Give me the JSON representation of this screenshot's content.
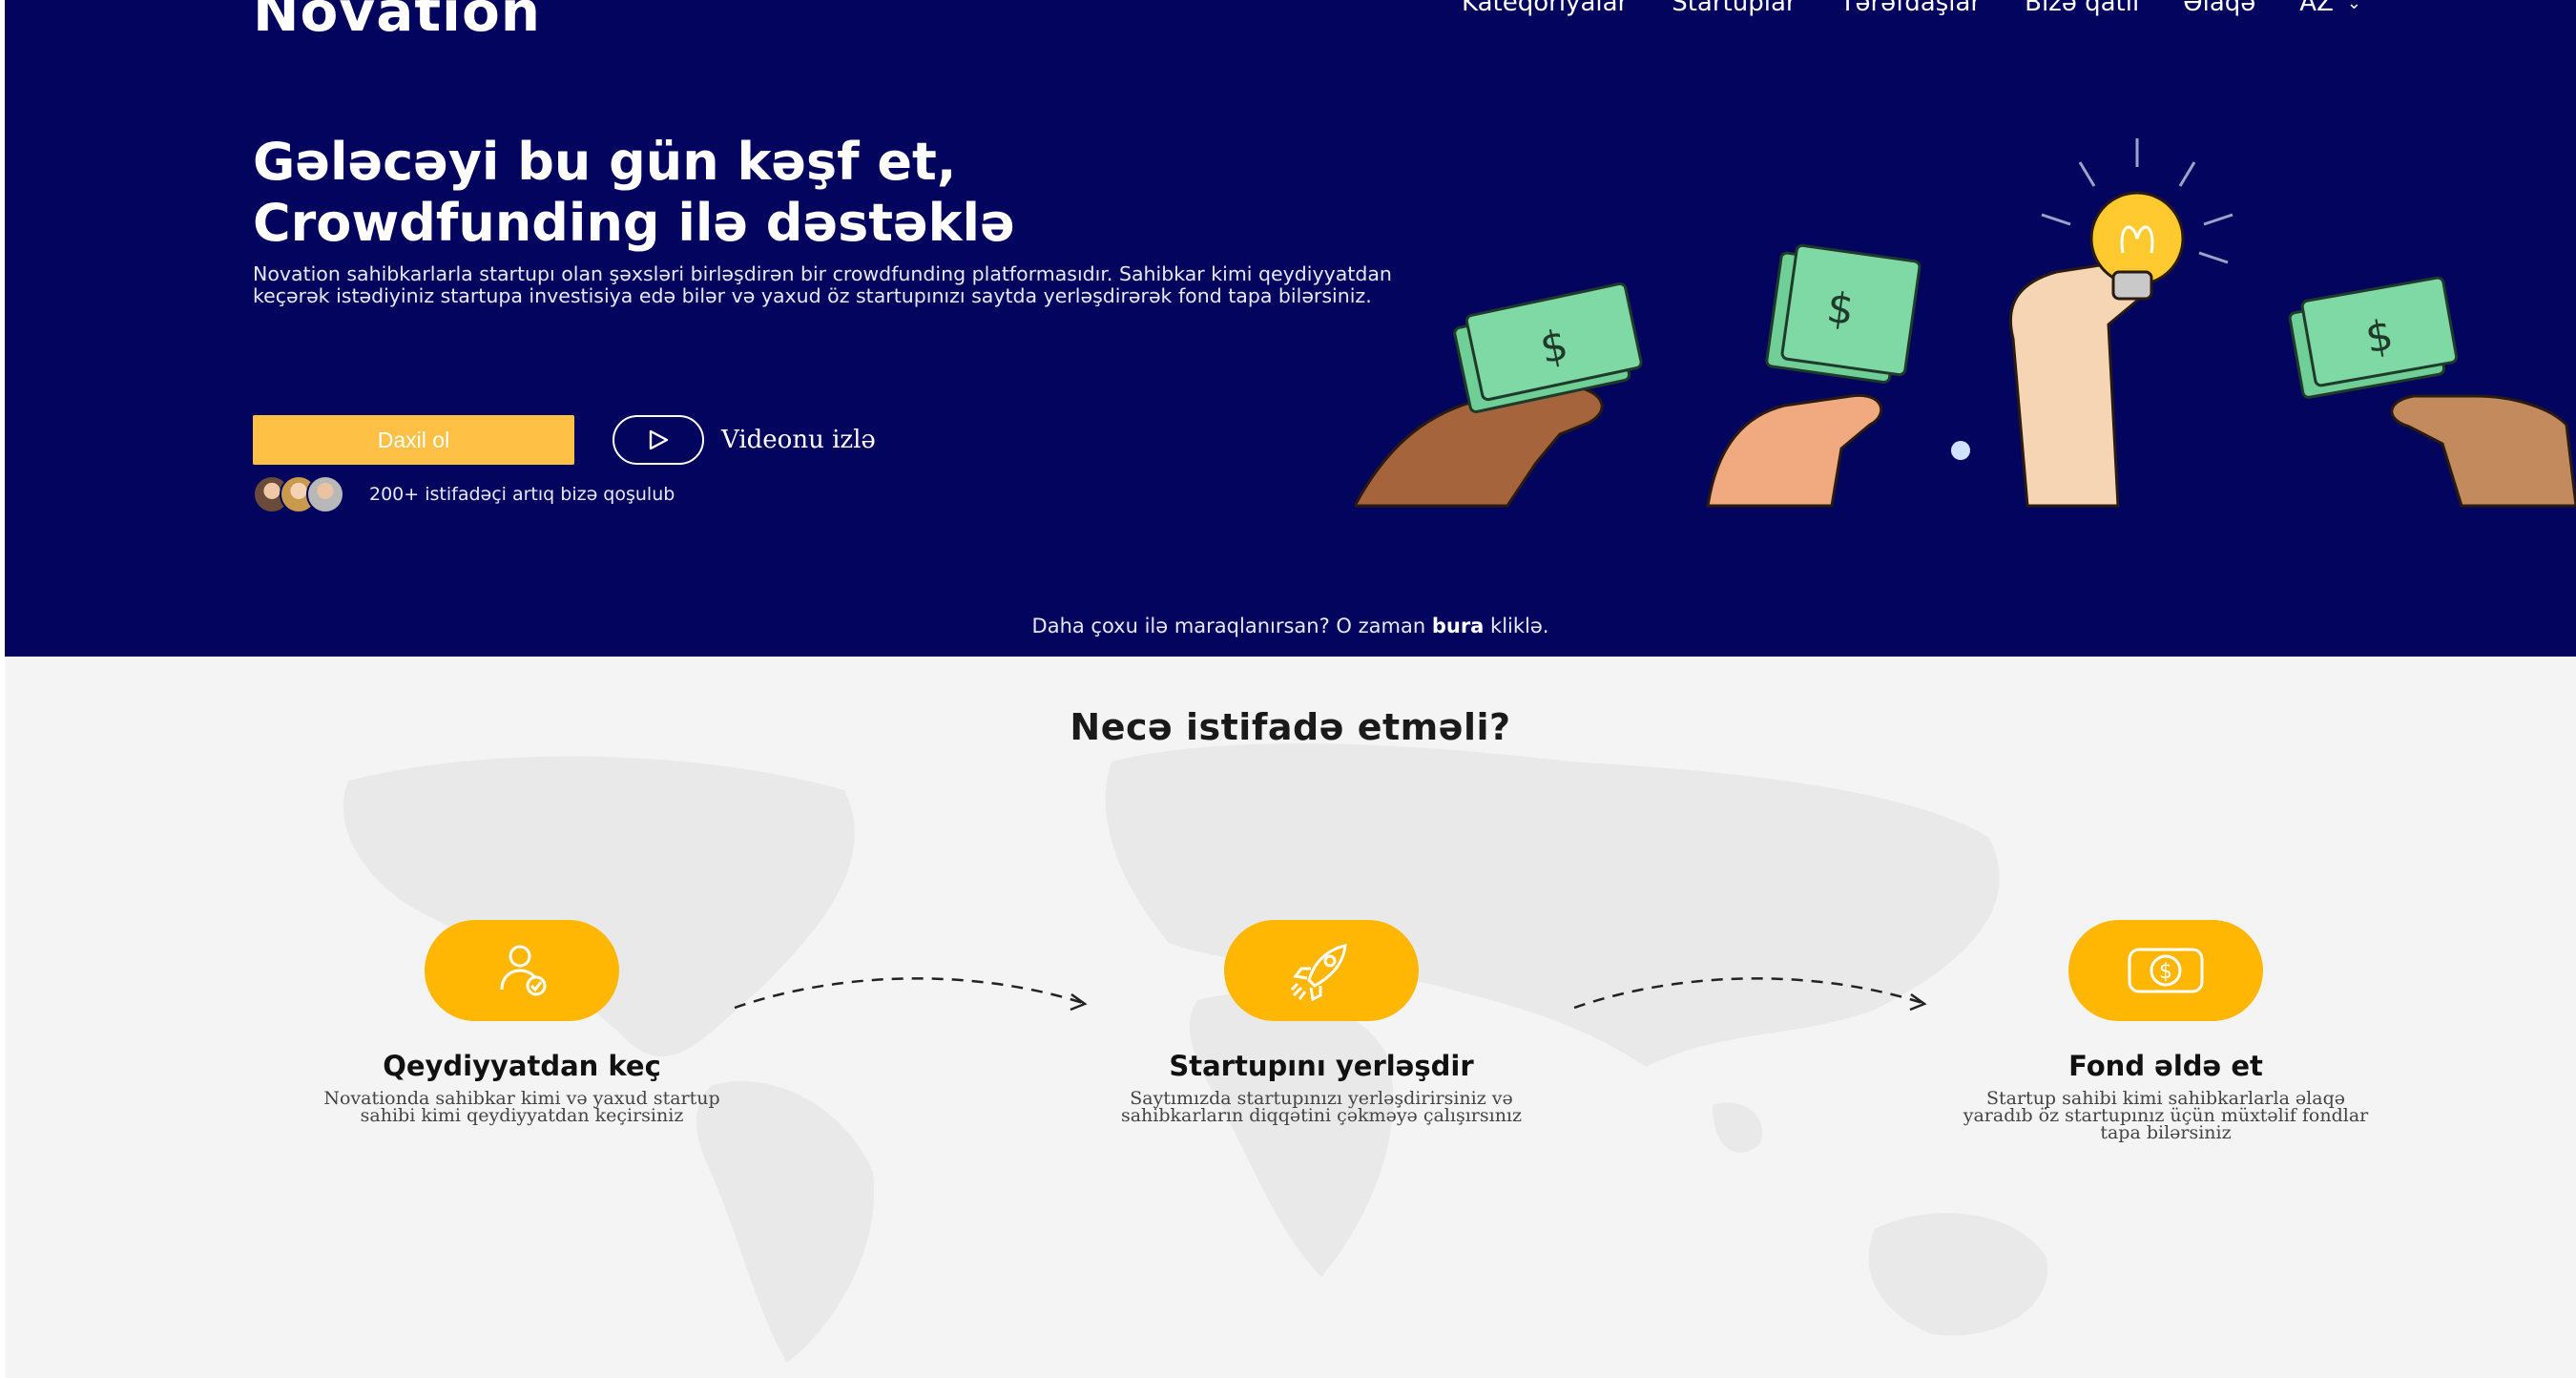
{
  "header": {
    "logo": "Novation",
    "nav": [
      "Kateqoriyalar",
      "Startuplar",
      "Tərəfdaşlar",
      "Bizə qatıl",
      "Əlaqə"
    ],
    "language": "AZ"
  },
  "hero": {
    "headline_line1": "Gələcəyi bu gün kəşf et,",
    "headline_line2": "Crowdfunding ilə dəstəklə",
    "description": "Novation sahibkarlarla startupı olan şəxsləri birləşdirən bir crowdfunding platformasıdır. Sahibkar kimi qeydiyyatdan keçərək istədiyiniz startupa investisiya edə bilər və yaxud öz startupınızı saytda yerləşdirərək fond tapa bilərsiniz.",
    "login_button": "Daxil ol",
    "video_label": "Videonu izlə",
    "users_text": "200+ istifadəçi artıq bizə qoşulub",
    "more_prefix": "Daha çoxu ilə maraqlanırsan? O zaman ",
    "more_link": "bura",
    "more_suffix": " kliklə."
  },
  "how": {
    "title": "Necə istifadə etməli?",
    "steps": [
      {
        "title": "Qeydiyyatdan keç",
        "text": "Novationda sahibkar kimi və yaxud startup sahibi kimi qeydiyyatdan keçirsiniz",
        "icon": "user-check-icon"
      },
      {
        "title": "Startupını yerləşdir",
        "text": "Saytımızda startupınızı yerləşdirirsiniz və sahibkarların diqqətini çəkməyə çalışırsınız",
        "icon": "rocket-icon"
      },
      {
        "title": "Fond əldə et",
        "text": "Startup sahibi kimi sahibkarlarla əlaqə yaradıb öz startupınız üçün müxtəlif fondlar tapa bilərsiniz",
        "icon": "dollar-icon"
      }
    ]
  },
  "colors": {
    "hero_bg": "#03045e",
    "accent_yellow": "#ffb703",
    "button_yellow": "#ffc145",
    "section_bg": "#f4f4f4"
  }
}
